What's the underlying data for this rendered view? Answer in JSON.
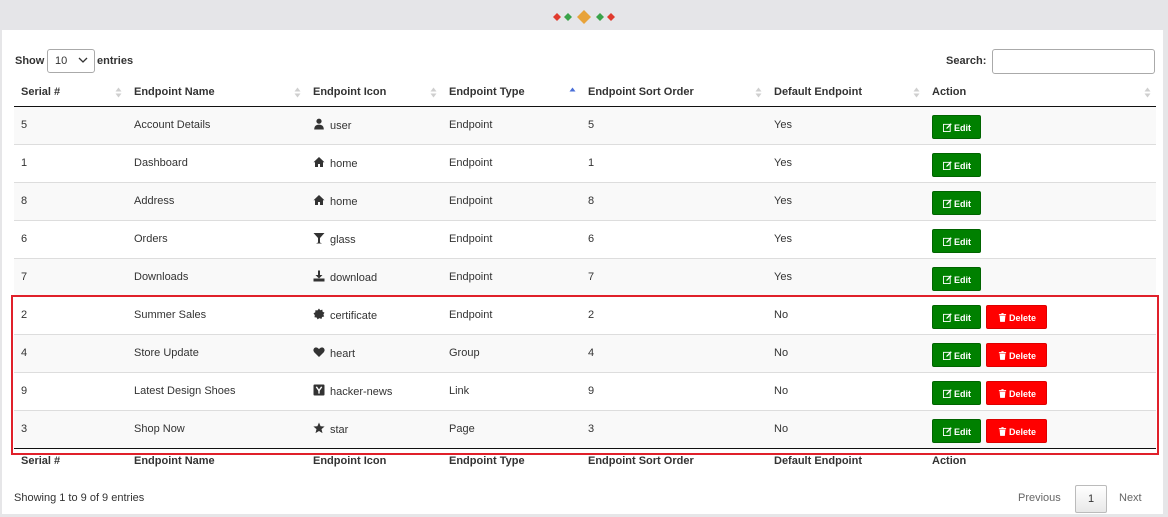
{
  "controls": {
    "show_label": "Show",
    "length_value": "10",
    "entries_label": "entries",
    "search_label": "Search:",
    "search_value": ""
  },
  "columns": [
    "Serial #",
    "Endpoint Name",
    "Endpoint Icon",
    "Endpoint Type",
    "Endpoint Sort Order",
    "Default Endpoint",
    "Action"
  ],
  "sorted_column": "Endpoint Type",
  "rows": [
    {
      "serial": "5",
      "name": "Account Details",
      "icon": "user",
      "type": "Endpoint",
      "sort": "5",
      "default": "Yes",
      "deletable": false
    },
    {
      "serial": "1",
      "name": "Dashboard",
      "icon": "home",
      "type": "Endpoint",
      "sort": "1",
      "default": "Yes",
      "deletable": false
    },
    {
      "serial": "8",
      "name": "Address",
      "icon": "home",
      "type": "Endpoint",
      "sort": "8",
      "default": "Yes",
      "deletable": false
    },
    {
      "serial": "6",
      "name": "Orders",
      "icon": "glass",
      "type": "Endpoint",
      "sort": "6",
      "default": "Yes",
      "deletable": false
    },
    {
      "serial": "7",
      "name": "Downloads",
      "icon": "download",
      "type": "Endpoint",
      "sort": "7",
      "default": "Yes",
      "deletable": false
    },
    {
      "serial": "2",
      "name": "Summer Sales",
      "icon": "certificate",
      "type": "Endpoint",
      "sort": "2",
      "default": "No",
      "deletable": true
    },
    {
      "serial": "4",
      "name": "Store Update",
      "icon": "heart",
      "type": "Group",
      "sort": "4",
      "default": "No",
      "deletable": true
    },
    {
      "serial": "9",
      "name": "Latest Design Shoes",
      "icon": "hacker-news",
      "type": "Link",
      "sort": "9",
      "default": "No",
      "deletable": true
    },
    {
      "serial": "3",
      "name": "Shop Now",
      "icon": "star",
      "type": "Page",
      "sort": "3",
      "default": "No",
      "deletable": true
    }
  ],
  "buttons": {
    "edit_label": "Edit",
    "delete_label": "Delete"
  },
  "footer": {
    "info": "Showing 1 to 9 of 9 entries",
    "previous": "Previous",
    "page": "1",
    "next": "Next"
  },
  "colors": {
    "edit": "#008000",
    "delete": "#ff0000",
    "highlight": "#e0202a"
  }
}
